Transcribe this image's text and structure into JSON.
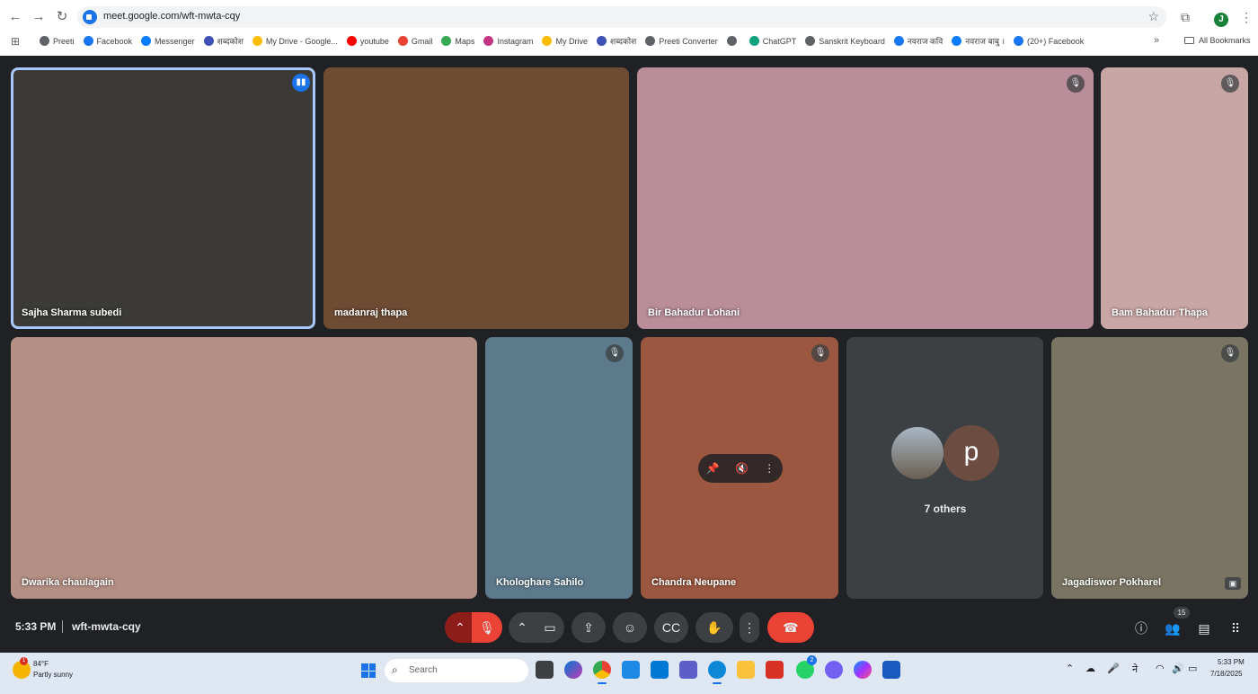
{
  "browser": {
    "url": "meet.google.com/wft-mwta-cqy",
    "bookmarks": [
      {
        "label": "Preeti",
        "color": "#5f6368"
      },
      {
        "label": "Facebook",
        "color": "#1877f2"
      },
      {
        "label": "Messenger",
        "color": "#0a7cff"
      },
      {
        "label": "शब्दकोश",
        "color": "#3f51b5"
      },
      {
        "label": "My Drive - Google...",
        "color": "#fbbc04"
      },
      {
        "label": "youtube",
        "color": "#ff0000"
      },
      {
        "label": "Gmail",
        "color": "#ea4335"
      },
      {
        "label": "Maps",
        "color": "#34a853"
      },
      {
        "label": "Instagram",
        "color": "#c13584"
      },
      {
        "label": "My Drive",
        "color": "#fbbc04"
      },
      {
        "label": "शब्दकोश",
        "color": "#3f51b5"
      },
      {
        "label": "Preeti Converter",
        "color": "#5f6368"
      },
      {
        "label": "",
        "color": "#5f6368"
      },
      {
        "label": "ChatGPT",
        "color": "#10a37f"
      },
      {
        "label": "Sanskrit Keyboard",
        "color": "#5f6368"
      },
      {
        "label": "नवराज कवि",
        "color": "#1877f2"
      },
      {
        "label": "नवराज बाबु ।",
        "color": "#0a7cff"
      },
      {
        "label": "(20+) Facebook",
        "color": "#1877f2"
      }
    ],
    "more_label": "»",
    "all_bookmarks": "All Bookmarks",
    "profile_initial": "J"
  },
  "tiles": [
    {
      "name": "Sajha Sharma subedi",
      "status": "speaking",
      "bg": "#3b3a36"
    },
    {
      "name": "madanraj thapa",
      "status": "none",
      "bg": "#6e4b33"
    },
    {
      "name": "Bir Bahadur Lohani",
      "status": "muted",
      "bg": "#b98d99"
    },
    {
      "name": "Bam Bahadur Thapa",
      "status": "muted",
      "bg": "#c9a6a6"
    },
    {
      "name": "Dwarika chaulagain",
      "status": "none",
      "bg": "#b48f84"
    },
    {
      "name": "Khologhare Sahilo",
      "status": "muted",
      "bg": "#5c7a8c"
    },
    {
      "name": "Chandra Neupane",
      "status": "muted",
      "bg": "#9b5740"
    },
    {
      "name": "7 others",
      "status": "group",
      "bg": "#3c4043"
    },
    {
      "name": "Jagadiswor Pokharel",
      "status": "muted",
      "bg": "#7a7563"
    }
  ],
  "others": {
    "label": "7 others",
    "avatar_letter": "p"
  },
  "meet": {
    "time": "5:33 PM",
    "code": "wft-mwta-cqy",
    "participant_count": "15"
  },
  "taskbar": {
    "weather_temp": "84°F",
    "weather_desc": "Partly sunny",
    "weather_badge": "1",
    "search_label": "Search",
    "whatsapp_badge": "2",
    "time": "5:33 PM",
    "date": "7/18/2025",
    "ime": "ने"
  }
}
